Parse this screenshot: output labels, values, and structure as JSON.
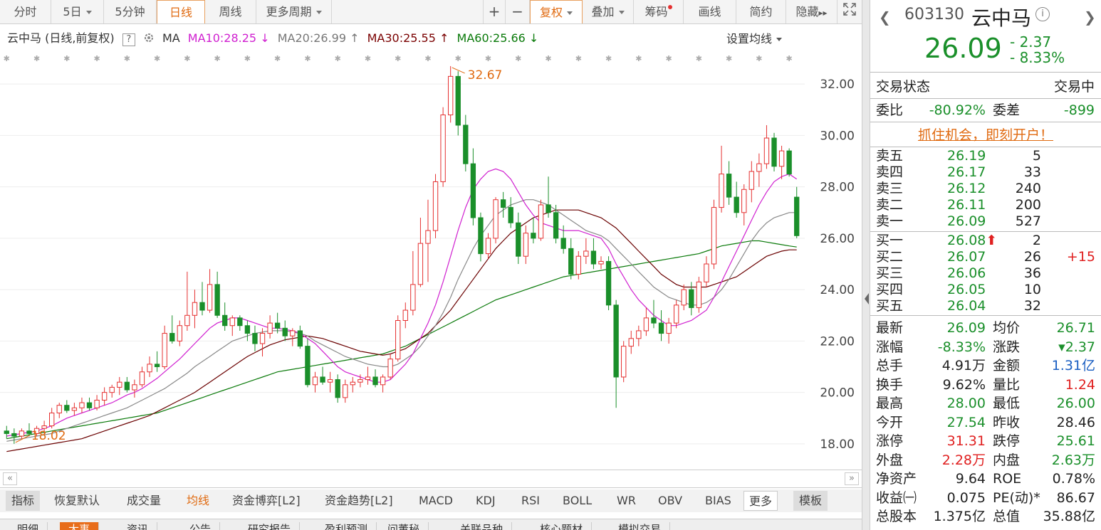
{
  "toolbar": {
    "left_tabs": [
      "分时",
      "5日",
      "5分钟",
      "日线",
      "周线",
      "更多周期"
    ],
    "right_tabs": [
      "+",
      "−",
      "复权",
      "叠加",
      "筹码",
      "画线",
      "简约",
      "隐藏",
      "▸▸"
    ],
    "active_tab": "日线"
  },
  "ma_line": {
    "title": "云中马 (日线,前复权)",
    "help": "?",
    "ma_label": "MA",
    "ma10": "MA10:28.25",
    "ma20": "MA20:26.99",
    "ma30": "MA30:25.55",
    "ma60": "MA60:25.66",
    "set_ma": "设置均线"
  },
  "colors": {
    "up": "#e53030",
    "down": "#1a8f2a",
    "ma10": "#d020d0",
    "ma20": "#888888",
    "ma30": "#6a0000",
    "ma60": "#0a7a0a",
    "accent": "#e06a10"
  },
  "chart_data": {
    "type": "candlestick",
    "y_ticks": [
      "32.00",
      "30.00",
      "28.00",
      "26.00",
      "24.00",
      "22.00",
      "20.00",
      "18.00"
    ],
    "ylim": [
      17.0,
      33.5
    ],
    "high_label": "32.67",
    "low_label": "18.02",
    "candles": [
      [
        18.5,
        18.7,
        18.2,
        18.4
      ],
      [
        18.4,
        18.6,
        18.0,
        18.3
      ],
      [
        18.3,
        18.6,
        18.2,
        18.5
      ],
      [
        18.5,
        18.8,
        18.3,
        18.4
      ],
      [
        18.4,
        18.7,
        18.3,
        18.6
      ],
      [
        18.6,
        18.9,
        18.4,
        18.7
      ],
      [
        18.7,
        19.4,
        18.6,
        19.2
      ],
      [
        19.2,
        19.6,
        19.0,
        19.5
      ],
      [
        19.5,
        19.7,
        19.2,
        19.3
      ],
      [
        19.3,
        19.6,
        19.1,
        19.4
      ],
      [
        19.4,
        19.8,
        19.2,
        19.6
      ],
      [
        19.6,
        19.8,
        19.3,
        19.4
      ],
      [
        19.4,
        19.9,
        19.3,
        19.7
      ],
      [
        19.7,
        20.2,
        19.5,
        20.0
      ],
      [
        20.0,
        20.3,
        19.8,
        20.2
      ],
      [
        20.2,
        20.6,
        19.9,
        20.4
      ],
      [
        20.4,
        20.6,
        20.0,
        20.1
      ],
      [
        20.1,
        20.5,
        19.8,
        20.3
      ],
      [
        20.3,
        21.0,
        20.2,
        20.8
      ],
      [
        20.8,
        21.4,
        20.6,
        21.1
      ],
      [
        21.1,
        21.6,
        20.8,
        21.0
      ],
      [
        21.0,
        22.6,
        20.9,
        22.3
      ],
      [
        22.3,
        23.0,
        21.9,
        22.0
      ],
      [
        22.0,
        22.8,
        21.8,
        22.6
      ],
      [
        22.6,
        24.7,
        22.4,
        23.0
      ],
      [
        23.0,
        24.0,
        22.5,
        23.5
      ],
      [
        23.5,
        24.3,
        23.0,
        23.2
      ],
      [
        23.2,
        24.8,
        23.1,
        24.2
      ],
      [
        24.2,
        24.7,
        22.9,
        23.0
      ],
      [
        23.0,
        23.5,
        22.4,
        22.6
      ],
      [
        22.6,
        23.0,
        22.2,
        22.9
      ],
      [
        22.9,
        23.0,
        22.4,
        22.6
      ],
      [
        22.6,
        22.8,
        22.0,
        22.3
      ],
      [
        22.3,
        22.6,
        21.6,
        21.9
      ],
      [
        21.9,
        22.5,
        21.4,
        22.3
      ],
      [
        22.3,
        23.0,
        22.1,
        22.7
      ],
      [
        22.7,
        23.1,
        22.3,
        22.5
      ],
      [
        22.5,
        22.8,
        22.0,
        22.2
      ],
      [
        22.2,
        22.5,
        21.8,
        22.4
      ],
      [
        22.4,
        22.6,
        21.7,
        21.8
      ],
      [
        21.8,
        22.1,
        20.2,
        20.3
      ],
      [
        20.3,
        20.8,
        20.0,
        20.6
      ],
      [
        20.6,
        21.0,
        20.3,
        20.4
      ],
      [
        20.4,
        20.8,
        20.0,
        20.5
      ],
      [
        20.5,
        20.7,
        19.6,
        19.8
      ],
      [
        19.8,
        20.5,
        19.6,
        20.3
      ],
      [
        20.3,
        20.6,
        20.0,
        20.4
      ],
      [
        20.4,
        20.7,
        20.2,
        20.5
      ],
      [
        20.5,
        21.0,
        20.3,
        20.6
      ],
      [
        20.6,
        20.9,
        20.2,
        20.3
      ],
      [
        20.3,
        20.7,
        20.0,
        20.6
      ],
      [
        20.6,
        21.5,
        20.5,
        21.3
      ],
      [
        21.3,
        23.0,
        21.2,
        22.8
      ],
      [
        22.8,
        23.5,
        22.5,
        23.2
      ],
      [
        23.2,
        25.5,
        23.0,
        24.2
      ],
      [
        24.2,
        26.8,
        24.1,
        25.8
      ],
      [
        25.8,
        27.5,
        24.3,
        26.3
      ],
      [
        26.3,
        28.5,
        26.0,
        28.2
      ],
      [
        28.2,
        31.1,
        28.0,
        30.8
      ],
      [
        30.8,
        32.7,
        30.5,
        32.3
      ],
      [
        32.3,
        32.5,
        30.0,
        30.4
      ],
      [
        30.4,
        30.8,
        28.6,
        28.9
      ],
      [
        28.9,
        29.5,
        26.5,
        26.8
      ],
      [
        26.8,
        27.0,
        25.1,
        25.4
      ],
      [
        25.4,
        26.2,
        25.2,
        26.0
      ],
      [
        26.0,
        27.6,
        25.8,
        27.5
      ],
      [
        27.5,
        27.8,
        26.8,
        27.2
      ],
      [
        27.2,
        27.6,
        26.4,
        26.6
      ],
      [
        26.6,
        27.0,
        25.0,
        25.3
      ],
      [
        25.3,
        26.5,
        25.0,
        26.2
      ],
      [
        26.2,
        26.8,
        25.8,
        26.0
      ],
      [
        26.0,
        27.5,
        25.9,
        27.3
      ],
      [
        27.3,
        28.4,
        26.8,
        27.0
      ],
      [
        27.0,
        27.3,
        25.8,
        26.0
      ],
      [
        26.0,
        26.5,
        25.4,
        25.6
      ],
      [
        25.6,
        26.0,
        24.4,
        24.6
      ],
      [
        24.6,
        25.5,
        24.4,
        25.3
      ],
      [
        25.3,
        26.0,
        25.0,
        25.5
      ],
      [
        25.5,
        26.0,
        24.8,
        25.0
      ],
      [
        25.0,
        25.3,
        24.8,
        25.1
      ],
      [
        25.1,
        25.3,
        23.2,
        23.4
      ],
      [
        23.4,
        23.6,
        19.4,
        20.6
      ],
      [
        20.6,
        22.0,
        20.4,
        21.8
      ],
      [
        21.8,
        22.4,
        21.5,
        22.1
      ],
      [
        22.1,
        22.6,
        21.8,
        22.4
      ],
      [
        22.4,
        23.3,
        22.2,
        22.9
      ],
      [
        22.9,
        23.6,
        22.5,
        22.7
      ],
      [
        22.7,
        23.2,
        22.0,
        22.3
      ],
      [
        22.3,
        22.9,
        21.9,
        22.7
      ],
      [
        22.7,
        23.6,
        22.5,
        23.4
      ],
      [
        23.4,
        24.2,
        23.2,
        24.0
      ],
      [
        24.0,
        24.3,
        23.0,
        23.3
      ],
      [
        23.3,
        24.5,
        23.1,
        24.3
      ],
      [
        24.3,
        25.3,
        24.1,
        25.0
      ],
      [
        25.0,
        27.5,
        24.8,
        27.2
      ],
      [
        27.2,
        29.6,
        27.0,
        28.5
      ],
      [
        28.5,
        29.0,
        27.3,
        27.6
      ],
      [
        27.6,
        28.2,
        26.8,
        27.0
      ],
      [
        27.0,
        28.1,
        26.5,
        27.9
      ],
      [
        27.9,
        29.0,
        27.4,
        28.6
      ],
      [
        28.6,
        29.3,
        28.0,
        28.9
      ],
      [
        28.9,
        30.4,
        28.7,
        29.9
      ],
      [
        29.9,
        30.1,
        28.6,
        28.8
      ],
      [
        28.8,
        29.6,
        28.3,
        29.4
      ],
      [
        29.4,
        29.5,
        28.4,
        28.5
      ],
      [
        27.6,
        28.0,
        26.0,
        26.1
      ]
    ],
    "ma10": [
      18.3,
      18.35,
      18.4,
      18.45,
      18.5,
      18.6,
      18.7,
      18.85,
      19.0,
      19.1,
      19.2,
      19.3,
      19.4,
      19.5,
      19.6,
      19.75,
      19.9,
      20.0,
      20.15,
      20.35,
      20.55,
      20.8,
      21.05,
      21.3,
      21.6,
      21.9,
      22.2,
      22.5,
      22.7,
      22.8,
      22.9,
      22.9,
      22.8,
      22.7,
      22.6,
      22.5,
      22.5,
      22.45,
      22.4,
      22.3,
      22.1,
      21.9,
      21.6,
      21.3,
      21.0,
      20.8,
      20.7,
      20.6,
      20.5,
      20.4,
      20.4,
      20.5,
      20.8,
      21.1,
      21.5,
      22.1,
      22.7,
      23.4,
      24.3,
      25.3,
      26.3,
      27.2,
      27.9,
      28.3,
      28.6,
      28.7,
      28.6,
      28.3,
      27.8,
      27.3,
      26.9,
      26.6,
      26.5,
      26.4,
      26.3,
      26.3,
      26.3,
      26.2,
      26.1,
      26.0,
      25.6,
      25.0,
      24.5,
      24.0,
      23.6,
      23.3,
      23.0,
      22.8,
      22.6,
      22.6,
      22.7,
      22.8,
      23.0,
      23.2,
      23.7,
      24.3,
      24.9,
      25.5,
      26.1,
      26.7,
      27.3,
      27.8,
      28.2,
      28.4,
      28.5,
      28.3
    ],
    "ma20": [
      18.1,
      18.15,
      18.2,
      18.25,
      18.3,
      18.35,
      18.4,
      18.5,
      18.6,
      18.7,
      18.8,
      18.9,
      19.0,
      19.1,
      19.2,
      19.3,
      19.4,
      19.55,
      19.7,
      19.85,
      20.0,
      20.15,
      20.35,
      20.55,
      20.75,
      21.0,
      21.2,
      21.4,
      21.6,
      21.8,
      22.0,
      22.1,
      22.2,
      22.3,
      22.35,
      22.4,
      22.4,
      22.4,
      22.35,
      22.3,
      22.2,
      22.0,
      21.85,
      21.7,
      21.55,
      21.4,
      21.3,
      21.2,
      21.1,
      21.05,
      21.0,
      21.0,
      21.1,
      21.3,
      21.5,
      21.8,
      22.2,
      22.6,
      23.1,
      23.7,
      24.4,
      25.0,
      25.6,
      26.1,
      26.5,
      26.9,
      27.1,
      27.3,
      27.4,
      27.5,
      27.5,
      27.4,
      27.3,
      27.1,
      26.9,
      26.7,
      26.5,
      26.3,
      26.2,
      26.1,
      25.9,
      25.6,
      25.3,
      25.0,
      24.7,
      24.4,
      24.1,
      23.9,
      23.7,
      23.6,
      23.5,
      23.4,
      23.4,
      23.5,
      23.7,
      24.0,
      24.4,
      24.9,
      25.4,
      25.9,
      26.3,
      26.6,
      26.8,
      26.9,
      27.0,
      27.0
    ],
    "ma30": [
      17.7,
      17.75,
      17.8,
      17.85,
      17.9,
      17.95,
      18.0,
      18.05,
      18.1,
      18.15,
      18.2,
      18.3,
      18.4,
      18.5,
      18.6,
      18.7,
      18.8,
      18.9,
      19.0,
      19.1,
      19.25,
      19.4,
      19.55,
      19.7,
      19.85,
      20.0,
      20.2,
      20.4,
      20.6,
      20.8,
      21.0,
      21.2,
      21.4,
      21.55,
      21.7,
      21.85,
      21.95,
      22.05,
      22.1,
      22.15,
      22.2,
      22.15,
      22.1,
      22.0,
      21.9,
      21.8,
      21.7,
      21.6,
      21.55,
      21.5,
      21.45,
      21.5,
      21.6,
      21.7,
      21.9,
      22.1,
      22.3,
      22.6,
      22.9,
      23.2,
      23.6,
      24.0,
      24.4,
      24.8,
      25.2,
      25.6,
      25.9,
      26.2,
      26.4,
      26.6,
      26.8,
      26.9,
      27.0,
      27.1,
      27.1,
      27.1,
      27.1,
      27.0,
      26.9,
      26.8,
      26.6,
      26.4,
      26.1,
      25.8,
      25.5,
      25.2,
      24.9,
      24.6,
      24.4,
      24.2,
      24.1,
      24.1,
      24.1,
      24.1,
      24.2,
      24.3,
      24.4,
      24.5,
      24.7,
      24.9,
      25.1,
      25.3,
      25.4,
      25.5,
      25.55,
      25.55
    ],
    "ma60": [
      18.2,
      18.25,
      18.3,
      18.35,
      18.4,
      18.45,
      18.5,
      18.55,
      18.6,
      18.65,
      18.7,
      18.75,
      18.8,
      18.85,
      18.9,
      18.95,
      19.0,
      19.05,
      19.1,
      19.15,
      19.2,
      19.3,
      19.4,
      19.5,
      19.6,
      19.7,
      19.8,
      19.9,
      20.0,
      20.1,
      20.2,
      20.3,
      20.4,
      20.5,
      20.6,
      20.7,
      20.8,
      20.85,
      20.9,
      20.95,
      21.0,
      21.05,
      21.1,
      21.15,
      21.2,
      21.25,
      21.3,
      21.35,
      21.4,
      21.45,
      21.5,
      21.6,
      21.7,
      21.8,
      21.95,
      22.1,
      22.25,
      22.4,
      22.55,
      22.7,
      22.85,
      23.0,
      23.15,
      23.3,
      23.45,
      23.6,
      23.7,
      23.8,
      23.9,
      24.0,
      24.1,
      24.2,
      24.3,
      24.4,
      24.5,
      24.55,
      24.6,
      24.65,
      24.7,
      24.75,
      24.8,
      24.85,
      24.9,
      24.95,
      25.0,
      25.05,
      25.1,
      25.15,
      25.2,
      25.25,
      25.3,
      25.35,
      25.4,
      25.5,
      25.6,
      25.7,
      25.75,
      25.8,
      25.85,
      25.9,
      25.9,
      25.85,
      25.8,
      25.75,
      25.7,
      25.66
    ]
  },
  "scroll": {
    "left": "«",
    "right": "»"
  },
  "indicator_tabs": [
    "指标",
    "恢复默认",
    "成交量",
    "均线",
    "资金博弈[L2]",
    "资金趋势[L2]",
    "MACD",
    "KDJ",
    "RSI",
    "BOLL",
    "WR",
    "OBV",
    "BIAS",
    "更多",
    "模板"
  ],
  "indicator_selected": "均线",
  "bottom_tabs": [
    "明细",
    "大事",
    "资讯",
    "公告",
    "研究报告",
    "盈利预测",
    "问董秘",
    "关联品种",
    "核心题材",
    "模拟交易"
  ],
  "bottom_selected": "大事",
  "quote": {
    "code": "603130",
    "name": "云中马",
    "price": "26.09",
    "change": "- 2.37",
    "change_pct": "- 8.33%",
    "status_label": "交易状态",
    "status_value": "交易中",
    "wb_label": "委比",
    "wb_value": "-80.92%",
    "wc_label": "委差",
    "wc_value": "-899",
    "ad": "抓住机会，即刻开户！",
    "asks": [
      {
        "label": "卖五",
        "price": "26.19",
        "vol": "5",
        "extra": ""
      },
      {
        "label": "卖四",
        "price": "26.17",
        "vol": "33",
        "extra": ""
      },
      {
        "label": "卖三",
        "price": "26.12",
        "vol": "240",
        "extra": ""
      },
      {
        "label": "卖二",
        "price": "26.11",
        "vol": "200",
        "extra": ""
      },
      {
        "label": "卖一",
        "price": "26.09",
        "vol": "527",
        "extra": ""
      }
    ],
    "bids": [
      {
        "label": "买一",
        "price": "26.08",
        "vol": "2",
        "extra": ""
      },
      {
        "label": "买二",
        "price": "26.07",
        "vol": "26",
        "extra": "+15"
      },
      {
        "label": "买三",
        "price": "26.06",
        "vol": "36",
        "extra": ""
      },
      {
        "label": "买四",
        "price": "26.05",
        "vol": "10",
        "extra": ""
      },
      {
        "label": "买五",
        "price": "26.04",
        "vol": "32",
        "extra": ""
      }
    ],
    "stats": [
      {
        "a": "最新",
        "b": "26.09",
        "bc": "g",
        "c": "均价",
        "d": "26.71",
        "dc": "g"
      },
      {
        "a": "涨幅",
        "b": "-8.33%",
        "bc": "g",
        "c": "涨跌",
        "d": "▾2.37",
        "dc": "g"
      },
      {
        "a": "总手",
        "b": "4.91万",
        "bc": "",
        "c": "金额",
        "d": "1.31亿",
        "dc": "blue"
      },
      {
        "a": "换手",
        "b": "9.62%",
        "bc": "",
        "c": "量比",
        "d": "1.24",
        "dc": "red"
      },
      {
        "a": "最高",
        "b": "28.00",
        "bc": "g",
        "c": "最低",
        "d": "26.00",
        "dc": "g"
      },
      {
        "a": "今开",
        "b": "27.54",
        "bc": "g",
        "c": "昨收",
        "d": "28.46",
        "dc": ""
      },
      {
        "a": "涨停",
        "b": "31.31",
        "bc": "red",
        "c": "跌停",
        "d": "25.61",
        "dc": "g"
      },
      {
        "a": "外盘",
        "b": "2.28万",
        "bc": "red",
        "c": "内盘",
        "d": "2.63万",
        "dc": "g"
      },
      {
        "a": "净资产",
        "b": "9.64",
        "bc": "",
        "c": "ROE",
        "d": "0.78%",
        "dc": ""
      },
      {
        "a": "收益㈠",
        "b": "0.075",
        "bc": "",
        "c": "PE(动)*",
        "d": "86.67",
        "dc": ""
      },
      {
        "a": "总股本",
        "b": "1.375亿",
        "bc": "",
        "c": "总值",
        "d": "35.88亿",
        "dc": ""
      }
    ]
  }
}
